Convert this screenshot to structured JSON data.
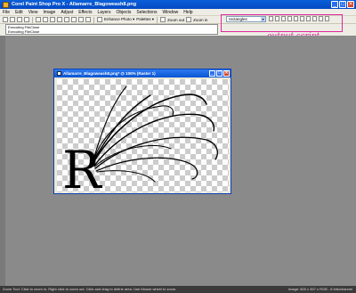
{
  "window": {
    "title": "Corel Paint Shop Pro X - Allamarre_Blagoweash8.png",
    "minimize": "_",
    "maximize": "□",
    "close": "✕"
  },
  "menu": [
    "File",
    "Edit",
    "View",
    "Image",
    "Adjust",
    "Effects",
    "Layers",
    "Objects",
    "Selections",
    "Window",
    "Help"
  ],
  "toolbar": {
    "enhance_photo": "Enhance Photo ▾",
    "palettes": "Palettes ▾",
    "zoom_out": "Zoom out",
    "zoom_in": "Zoom in"
  },
  "script": {
    "selected": "rectangles"
  },
  "output": {
    "lines": [
      "Executing FileClose",
      "Executing FileClose"
    ]
  },
  "annotation": {
    "text": "output script"
  },
  "image_window": {
    "title": "Allamarre_Blagoweash8.png* @ 100% (Raster 1)",
    "letter": "R"
  },
  "status": {
    "left": "Zoom Tool: Click to zoom in, Right click to zoom out. Click and drag to define area. Use Mouse wheel to zoom.",
    "right": "Image: 800 x 457 x RGB - 8 bits/channel"
  },
  "colors": {
    "annotation": "#e0269b",
    "titlebar": "#0a5fd8",
    "workspace": "#8a8a8a"
  }
}
